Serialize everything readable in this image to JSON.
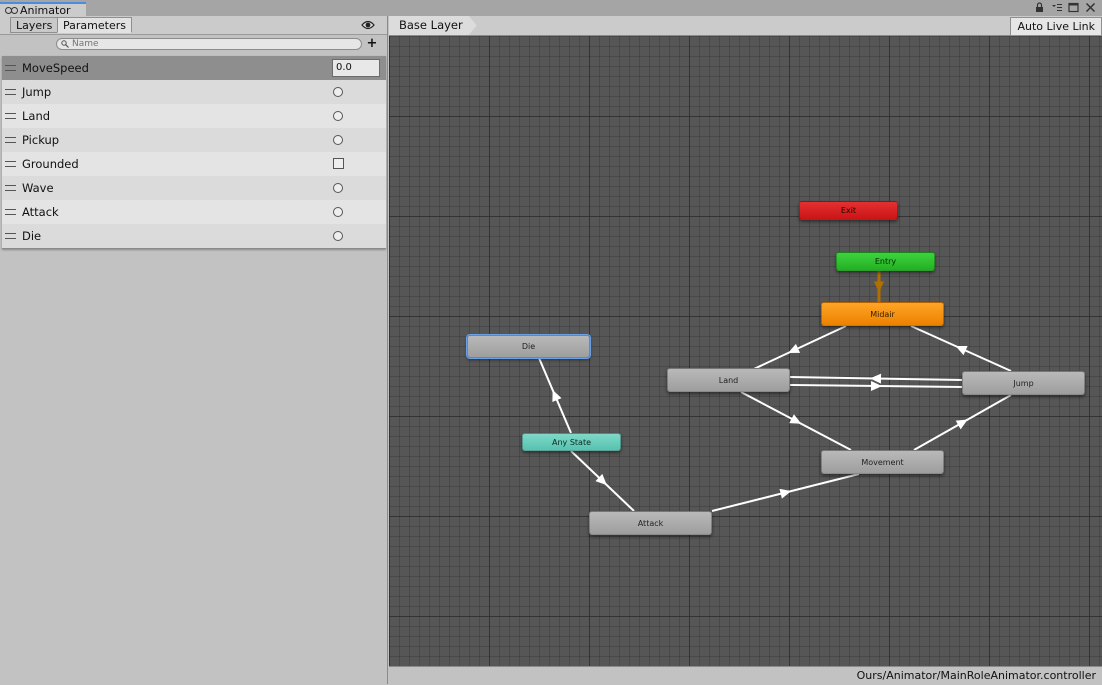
{
  "window": {
    "tab_title": "Animator"
  },
  "left": {
    "tabs": [
      {
        "label": "Layers"
      },
      {
        "label": "Parameters"
      }
    ],
    "search": {
      "placeholder": "Name",
      "value": ""
    },
    "add_label": "+",
    "parameters": [
      {
        "name": "MoveSpeed",
        "type": "float",
        "value": "0.0",
        "selected": true
      },
      {
        "name": "Jump",
        "type": "trigger"
      },
      {
        "name": "Land",
        "type": "trigger"
      },
      {
        "name": "Pickup",
        "type": "trigger"
      },
      {
        "name": "Grounded",
        "type": "bool",
        "value": false
      },
      {
        "name": "Wave",
        "type": "trigger"
      },
      {
        "name": "Attack",
        "type": "trigger"
      },
      {
        "name": "Die",
        "type": "trigger"
      }
    ]
  },
  "graph": {
    "breadcrumb": "Base Layer",
    "auto_live_link": "Auto Live Link",
    "states": {
      "exit": "Exit",
      "entry": "Entry",
      "midair": "Midair",
      "die": "Die",
      "land": "Land",
      "jump": "Jump",
      "any_state": "Any State",
      "movement": "Movement",
      "attack": "Attack"
    },
    "colors": {
      "exit": "#d92222",
      "entry": "#2fc42f",
      "midair": "#f59012",
      "any_state": "#6ccfbe",
      "state": "#a8a8a8",
      "grid": "#565656"
    }
  },
  "status": {
    "path": "Ours/Animator/MainRoleAnimator.controller"
  }
}
